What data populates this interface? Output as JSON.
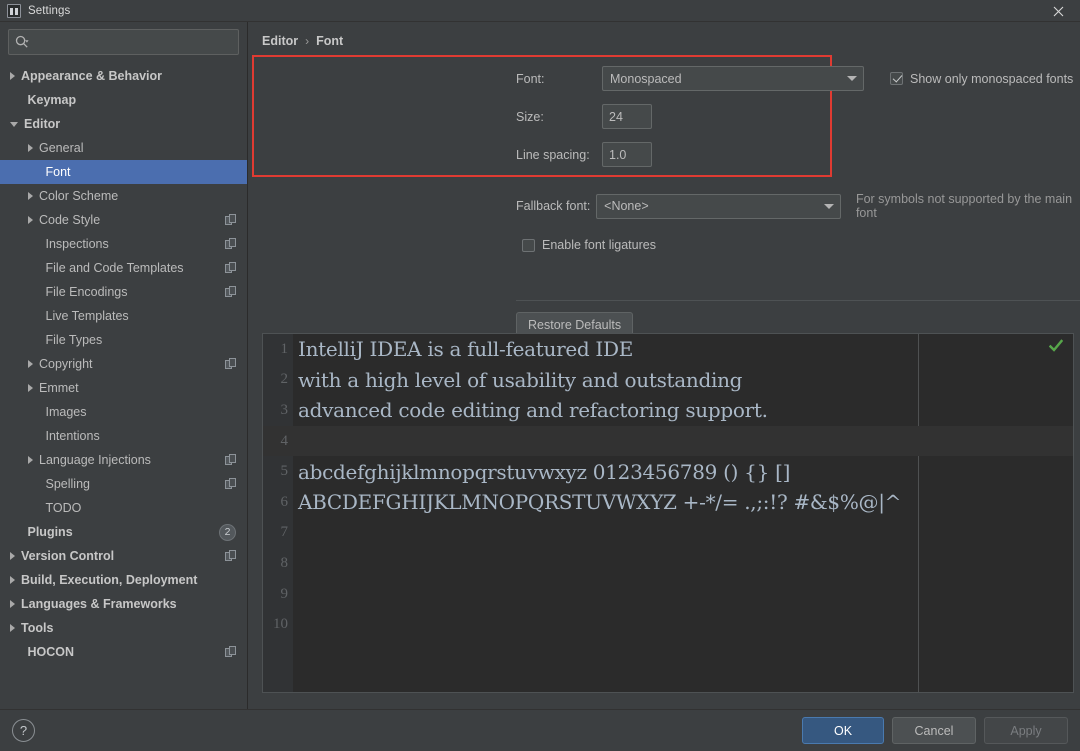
{
  "window": {
    "title": "Settings",
    "app_icon": "intellij-idea-icon",
    "close_label": "✕"
  },
  "sidebar": {
    "search": {
      "placeholder": "",
      "value": "",
      "icon": "search-icon"
    },
    "items": [
      {
        "label": "Appearance & Behavior",
        "indent": 0,
        "arrow": "right",
        "bold": true,
        "selected": false,
        "copy": false
      },
      {
        "label": "Keymap",
        "indent": 0,
        "arrow": "none",
        "bold": true,
        "selected": false,
        "copy": false
      },
      {
        "label": "Editor",
        "indent": 0,
        "arrow": "down",
        "bold": true,
        "selected": false,
        "copy": false
      },
      {
        "label": "General",
        "indent": 1,
        "arrow": "right",
        "bold": false,
        "selected": false,
        "copy": false
      },
      {
        "label": "Font",
        "indent": 1,
        "arrow": "none",
        "bold": false,
        "selected": true,
        "copy": false
      },
      {
        "label": "Color Scheme",
        "indent": 1,
        "arrow": "right",
        "bold": false,
        "selected": false,
        "copy": false
      },
      {
        "label": "Code Style",
        "indent": 1,
        "arrow": "right",
        "bold": false,
        "selected": false,
        "copy": true
      },
      {
        "label": "Inspections",
        "indent": 1,
        "arrow": "none",
        "bold": false,
        "selected": false,
        "copy": true
      },
      {
        "label": "File and Code Templates",
        "indent": 1,
        "arrow": "none",
        "bold": false,
        "selected": false,
        "copy": true
      },
      {
        "label": "File Encodings",
        "indent": 1,
        "arrow": "none",
        "bold": false,
        "selected": false,
        "copy": true
      },
      {
        "label": "Live Templates",
        "indent": 1,
        "arrow": "none",
        "bold": false,
        "selected": false,
        "copy": false
      },
      {
        "label": "File Types",
        "indent": 1,
        "arrow": "none",
        "bold": false,
        "selected": false,
        "copy": false
      },
      {
        "label": "Copyright",
        "indent": 1,
        "arrow": "right",
        "bold": false,
        "selected": false,
        "copy": true
      },
      {
        "label": "Emmet",
        "indent": 1,
        "arrow": "right",
        "bold": false,
        "selected": false,
        "copy": false
      },
      {
        "label": "Images",
        "indent": 1,
        "arrow": "none",
        "bold": false,
        "selected": false,
        "copy": false
      },
      {
        "label": "Intentions",
        "indent": 1,
        "arrow": "none",
        "bold": false,
        "selected": false,
        "copy": false
      },
      {
        "label": "Language Injections",
        "indent": 1,
        "arrow": "right",
        "bold": false,
        "selected": false,
        "copy": true
      },
      {
        "label": "Spelling",
        "indent": 1,
        "arrow": "none",
        "bold": false,
        "selected": false,
        "copy": true
      },
      {
        "label": "TODO",
        "indent": 1,
        "arrow": "none",
        "bold": false,
        "selected": false,
        "copy": false
      },
      {
        "label": "Plugins",
        "indent": 0,
        "arrow": "none",
        "bold": true,
        "selected": false,
        "copy": false,
        "badge": "2"
      },
      {
        "label": "Version Control",
        "indent": 0,
        "arrow": "right",
        "bold": true,
        "selected": false,
        "copy": true
      },
      {
        "label": "Build, Execution, Deployment",
        "indent": 0,
        "arrow": "right",
        "bold": true,
        "selected": false,
        "copy": false
      },
      {
        "label": "Languages & Frameworks",
        "indent": 0,
        "arrow": "right",
        "bold": true,
        "selected": false,
        "copy": false
      },
      {
        "label": "Tools",
        "indent": 0,
        "arrow": "right",
        "bold": true,
        "selected": false,
        "copy": false
      },
      {
        "label": "HOCON",
        "indent": 0,
        "arrow": "none",
        "bold": true,
        "selected": false,
        "copy": true
      }
    ]
  },
  "breadcrumb": {
    "parent": "Editor",
    "separator": "›",
    "current": "Font"
  },
  "font_panel": {
    "highlight_color": "#e03b32",
    "font_label": "Font:",
    "font_value": "Monospaced",
    "monospaced_checkbox_label": "Show only monospaced fonts",
    "monospaced_checked": true,
    "size_label": "Size:",
    "size_value": "24",
    "line_spacing_label": "Line spacing:",
    "line_spacing_value": "1.0"
  },
  "fallback": {
    "label": "Fallback font:",
    "value": "<None>",
    "hint": "For symbols not supported by the main font"
  },
  "ligatures": {
    "label": "Enable font ligatures",
    "checked": false
  },
  "restore_defaults_label": "Restore Defaults",
  "preview": {
    "status_icon": "green-checkmark-icon",
    "lines": [
      {
        "num": "1",
        "text": "IntelliJ IDEA is a full-featured IDE",
        "current": false
      },
      {
        "num": "2",
        "text": "with a high level of usability and outstanding",
        "current": false
      },
      {
        "num": "3",
        "text": "advanced code editing and refactoring support.",
        "current": false
      },
      {
        "num": "4",
        "text": "",
        "current": true
      },
      {
        "num": "5",
        "text": "abcdefghijklmnopqrstuvwxyz 0123456789 () {} []",
        "current": false
      },
      {
        "num": "6",
        "text": "ABCDEFGHIJKLMNOPQRSTUVWXYZ +-*/= .,;:!? #&$%@|^",
        "current": false
      },
      {
        "num": "7",
        "text": "",
        "current": false
      },
      {
        "num": "8",
        "text": "",
        "current": false
      },
      {
        "num": "9",
        "text": "",
        "current": false
      },
      {
        "num": "10",
        "text": "",
        "current": false
      }
    ]
  },
  "footer": {
    "help_label": "?",
    "ok_label": "OK",
    "cancel_label": "Cancel",
    "apply_label": "Apply"
  }
}
